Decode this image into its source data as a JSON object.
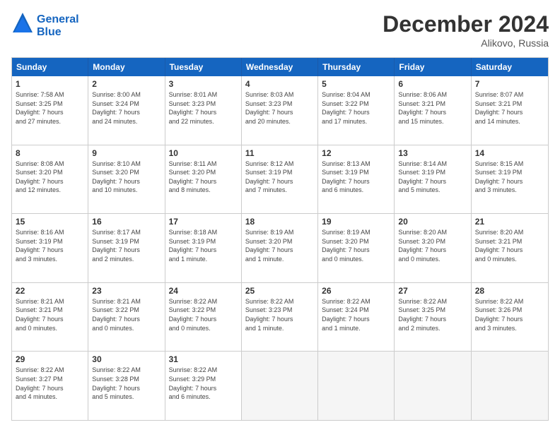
{
  "header": {
    "logo_line1": "General",
    "logo_line2": "Blue",
    "month": "December 2024",
    "location": "Alikovo, Russia"
  },
  "weekdays": [
    "Sunday",
    "Monday",
    "Tuesday",
    "Wednesday",
    "Thursday",
    "Friday",
    "Saturday"
  ],
  "rows": [
    [
      {
        "day": "1",
        "info": "Sunrise: 7:58 AM\nSunset: 3:25 PM\nDaylight: 7 hours\nand 27 minutes."
      },
      {
        "day": "2",
        "info": "Sunrise: 8:00 AM\nSunset: 3:24 PM\nDaylight: 7 hours\nand 24 minutes."
      },
      {
        "day": "3",
        "info": "Sunrise: 8:01 AM\nSunset: 3:23 PM\nDaylight: 7 hours\nand 22 minutes."
      },
      {
        "day": "4",
        "info": "Sunrise: 8:03 AM\nSunset: 3:23 PM\nDaylight: 7 hours\nand 20 minutes."
      },
      {
        "day": "5",
        "info": "Sunrise: 8:04 AM\nSunset: 3:22 PM\nDaylight: 7 hours\nand 17 minutes."
      },
      {
        "day": "6",
        "info": "Sunrise: 8:06 AM\nSunset: 3:21 PM\nDaylight: 7 hours\nand 15 minutes."
      },
      {
        "day": "7",
        "info": "Sunrise: 8:07 AM\nSunset: 3:21 PM\nDaylight: 7 hours\nand 14 minutes."
      }
    ],
    [
      {
        "day": "8",
        "info": "Sunrise: 8:08 AM\nSunset: 3:20 PM\nDaylight: 7 hours\nand 12 minutes."
      },
      {
        "day": "9",
        "info": "Sunrise: 8:10 AM\nSunset: 3:20 PM\nDaylight: 7 hours\nand 10 minutes."
      },
      {
        "day": "10",
        "info": "Sunrise: 8:11 AM\nSunset: 3:20 PM\nDaylight: 7 hours\nand 8 minutes."
      },
      {
        "day": "11",
        "info": "Sunrise: 8:12 AM\nSunset: 3:19 PM\nDaylight: 7 hours\nand 7 minutes."
      },
      {
        "day": "12",
        "info": "Sunrise: 8:13 AM\nSunset: 3:19 PM\nDaylight: 7 hours\nand 6 minutes."
      },
      {
        "day": "13",
        "info": "Sunrise: 8:14 AM\nSunset: 3:19 PM\nDaylight: 7 hours\nand 5 minutes."
      },
      {
        "day": "14",
        "info": "Sunrise: 8:15 AM\nSunset: 3:19 PM\nDaylight: 7 hours\nand 3 minutes."
      }
    ],
    [
      {
        "day": "15",
        "info": "Sunrise: 8:16 AM\nSunset: 3:19 PM\nDaylight: 7 hours\nand 3 minutes."
      },
      {
        "day": "16",
        "info": "Sunrise: 8:17 AM\nSunset: 3:19 PM\nDaylight: 7 hours\nand 2 minutes."
      },
      {
        "day": "17",
        "info": "Sunrise: 8:18 AM\nSunset: 3:19 PM\nDaylight: 7 hours\nand 1 minute."
      },
      {
        "day": "18",
        "info": "Sunrise: 8:19 AM\nSunset: 3:20 PM\nDaylight: 7 hours\nand 1 minute."
      },
      {
        "day": "19",
        "info": "Sunrise: 8:19 AM\nSunset: 3:20 PM\nDaylight: 7 hours\nand 0 minutes."
      },
      {
        "day": "20",
        "info": "Sunrise: 8:20 AM\nSunset: 3:20 PM\nDaylight: 7 hours\nand 0 minutes."
      },
      {
        "day": "21",
        "info": "Sunrise: 8:20 AM\nSunset: 3:21 PM\nDaylight: 7 hours\nand 0 minutes."
      }
    ],
    [
      {
        "day": "22",
        "info": "Sunrise: 8:21 AM\nSunset: 3:21 PM\nDaylight: 7 hours\nand 0 minutes."
      },
      {
        "day": "23",
        "info": "Sunrise: 8:21 AM\nSunset: 3:22 PM\nDaylight: 7 hours\nand 0 minutes."
      },
      {
        "day": "24",
        "info": "Sunrise: 8:22 AM\nSunset: 3:22 PM\nDaylight: 7 hours\nand 0 minutes."
      },
      {
        "day": "25",
        "info": "Sunrise: 8:22 AM\nSunset: 3:23 PM\nDaylight: 7 hours\nand 1 minute."
      },
      {
        "day": "26",
        "info": "Sunrise: 8:22 AM\nSunset: 3:24 PM\nDaylight: 7 hours\nand 1 minute."
      },
      {
        "day": "27",
        "info": "Sunrise: 8:22 AM\nSunset: 3:25 PM\nDaylight: 7 hours\nand 2 minutes."
      },
      {
        "day": "28",
        "info": "Sunrise: 8:22 AM\nSunset: 3:26 PM\nDaylight: 7 hours\nand 3 minutes."
      }
    ],
    [
      {
        "day": "29",
        "info": "Sunrise: 8:22 AM\nSunset: 3:27 PM\nDaylight: 7 hours\nand 4 minutes."
      },
      {
        "day": "30",
        "info": "Sunrise: 8:22 AM\nSunset: 3:28 PM\nDaylight: 7 hours\nand 5 minutes."
      },
      {
        "day": "31",
        "info": "Sunrise: 8:22 AM\nSunset: 3:29 PM\nDaylight: 7 hours\nand 6 minutes."
      },
      {
        "day": "",
        "info": ""
      },
      {
        "day": "",
        "info": ""
      },
      {
        "day": "",
        "info": ""
      },
      {
        "day": "",
        "info": ""
      }
    ]
  ]
}
